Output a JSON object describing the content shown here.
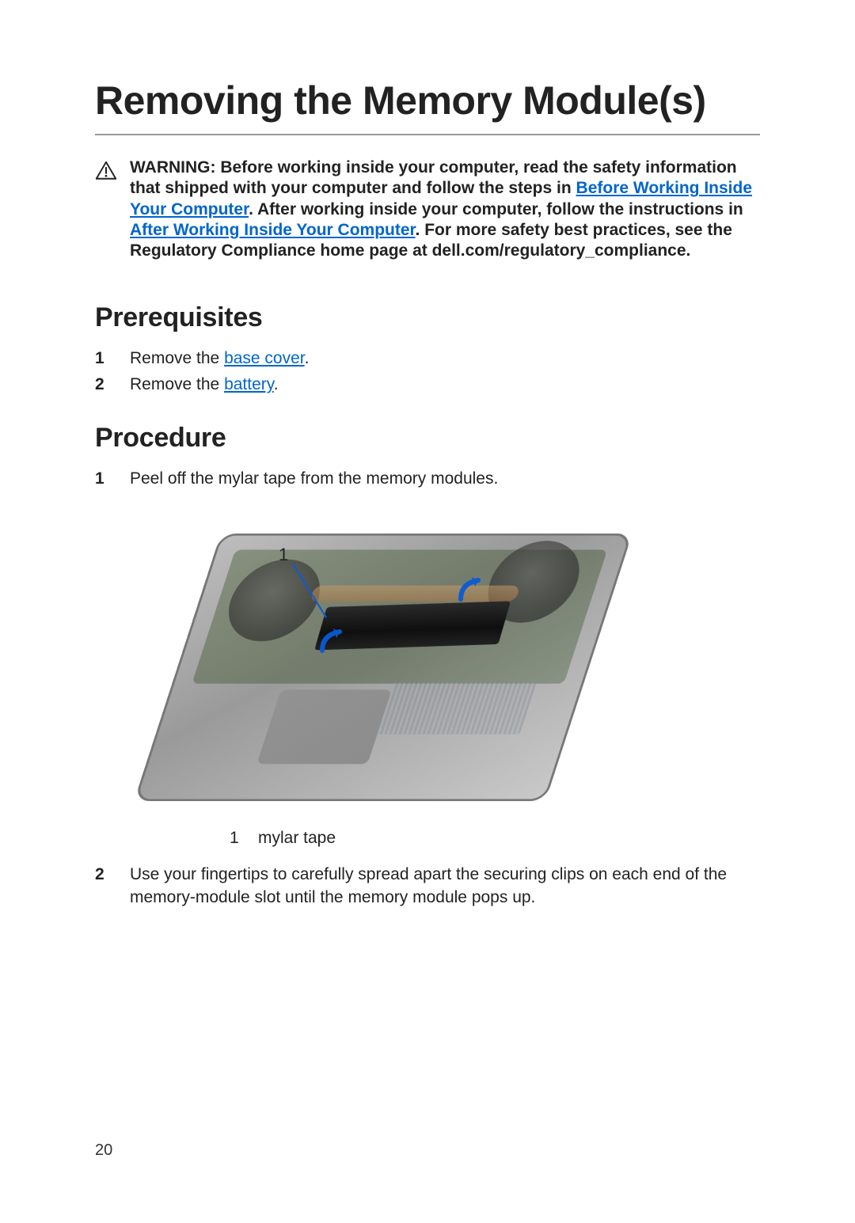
{
  "title": "Removing the Memory Module(s)",
  "warning": {
    "prefix": "WARNING: Before working inside your computer, read the safety information that shipped with your computer and follow the steps in ",
    "link1": "Before Working Inside Your Computer",
    "mid1": ". After working inside your computer, follow the instructions in ",
    "link2": "After Working Inside Your Computer",
    "suffix": ". For more safety best practices, see the Regulatory Compliance home page at dell.com/regulatory_compliance."
  },
  "sections": {
    "prereq": {
      "heading": "Prerequisites",
      "items": [
        {
          "num": "1",
          "text_before": "Remove the ",
          "link": "base cover",
          "text_after": "."
        },
        {
          "num": "2",
          "text_before": "Remove the ",
          "link": "battery",
          "text_after": "."
        }
      ]
    },
    "procedure": {
      "heading": "Procedure",
      "items": [
        {
          "num": "1",
          "text": "Peel off the mylar tape from the memory modules."
        },
        {
          "num": "2",
          "text": "Use your fingertips to carefully spread apart the securing clips on each end of the memory-module slot until the memory module pops up."
        }
      ]
    }
  },
  "figure": {
    "callout_num": "1",
    "legend_num": "1",
    "legend_text": "mylar tape"
  },
  "page_number": "20"
}
